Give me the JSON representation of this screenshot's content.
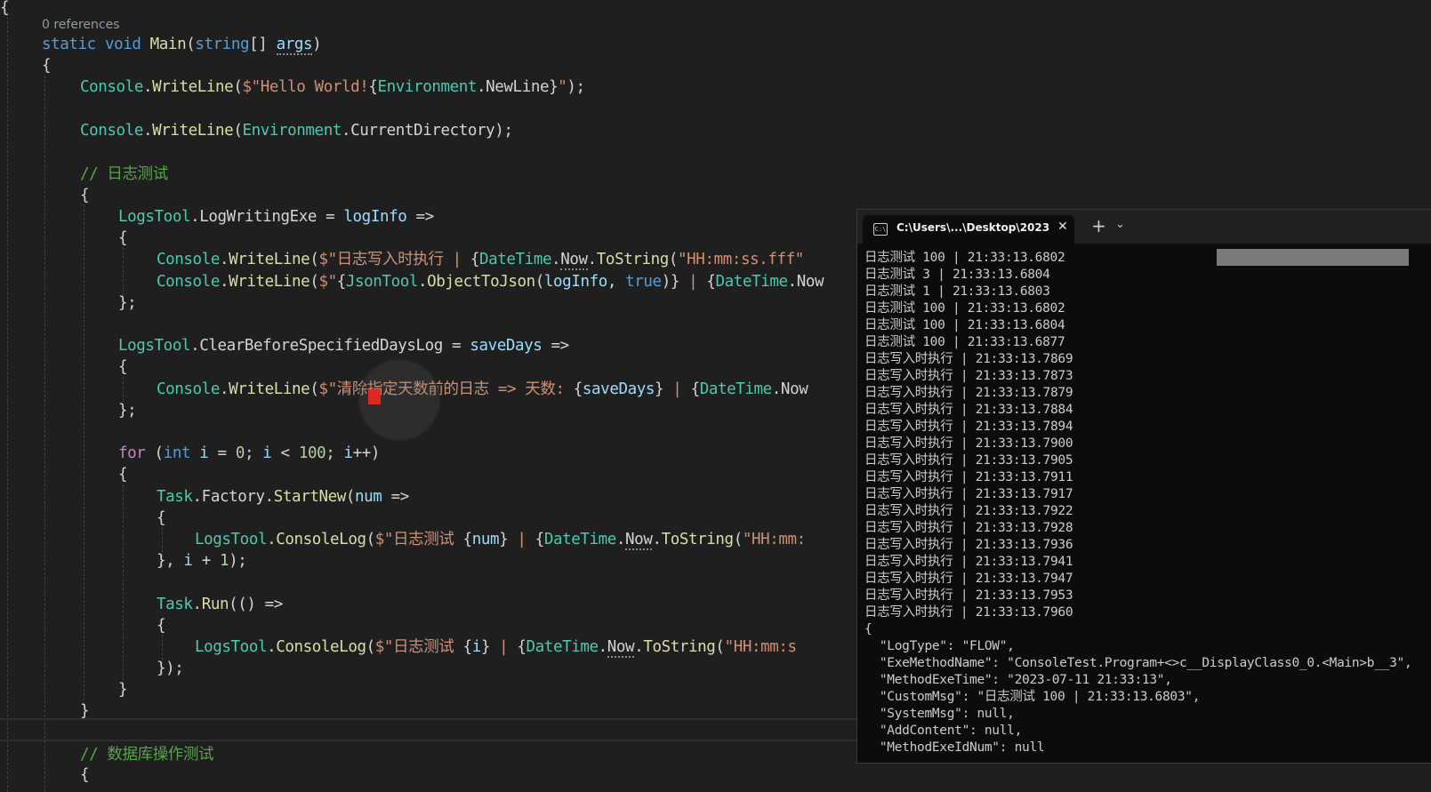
{
  "editor": {
    "references": "0 references",
    "lines": [
      {
        "spans": [
          {
            "c": "",
            "t": "{"
          }
        ]
      },
      {
        "spans": [
          {
            "c": "kw",
            "t": "static"
          },
          {
            "c": "",
            "t": " "
          },
          {
            "c": "kw",
            "t": "void"
          },
          {
            "c": "",
            "t": " "
          },
          {
            "c": "fn",
            "t": "Main"
          },
          {
            "c": "",
            "t": "("
          },
          {
            "c": "kw",
            "t": "string"
          },
          {
            "c": "",
            "t": "[] "
          },
          {
            "c": "var hint",
            "t": "args"
          },
          {
            "c": "",
            "t": ")"
          }
        ]
      },
      {
        "spans": [
          {
            "c": "",
            "t": "{"
          }
        ]
      },
      {
        "spans": [
          {
            "c": "ty",
            "t": "Console"
          },
          {
            "c": "",
            "t": "."
          },
          {
            "c": "fn",
            "t": "WriteLine"
          },
          {
            "c": "",
            "t": "("
          },
          {
            "c": "str",
            "t": "$\"Hello World!"
          },
          {
            "c": "",
            "t": "{"
          },
          {
            "c": "ty",
            "t": "Environment"
          },
          {
            "c": "",
            "t": ".NewLine}"
          },
          {
            "c": "str",
            "t": "\""
          },
          {
            "c": "",
            "t": ");"
          }
        ]
      },
      {
        "spans": [
          {
            "c": "ty",
            "t": "Console"
          },
          {
            "c": "",
            "t": "."
          },
          {
            "c": "fn",
            "t": "WriteLine"
          },
          {
            "c": "",
            "t": "("
          },
          {
            "c": "ty",
            "t": "Environment"
          },
          {
            "c": "",
            "t": ".CurrentDirectory);"
          }
        ]
      },
      {
        "spans": [
          {
            "c": "cm",
            "t": "// 日志测试"
          }
        ]
      },
      {
        "spans": [
          {
            "c": "",
            "t": "{"
          }
        ]
      },
      {
        "spans": [
          {
            "c": "ty",
            "t": "LogsTool"
          },
          {
            "c": "",
            "t": ".LogWritingExe = "
          },
          {
            "c": "var",
            "t": "logInfo"
          },
          {
            "c": "",
            "t": " =>"
          }
        ]
      },
      {
        "spans": [
          {
            "c": "",
            "t": "{"
          }
        ]
      },
      {
        "spans": [
          {
            "c": "ty",
            "t": "Console"
          },
          {
            "c": "",
            "t": "."
          },
          {
            "c": "fn",
            "t": "WriteLine"
          },
          {
            "c": "",
            "t": "("
          },
          {
            "c": "str",
            "t": "$\"日志写入时执行 | "
          },
          {
            "c": "",
            "t": "{"
          },
          {
            "c": "ty",
            "t": "DateTime"
          },
          {
            "c": "",
            "t": "."
          },
          {
            "c": "hint",
            "t": "Now"
          },
          {
            "c": "",
            "t": "."
          },
          {
            "c": "fn",
            "t": "ToString"
          },
          {
            "c": "",
            "t": "("
          },
          {
            "c": "str",
            "t": "\"HH:mm:ss.fff\""
          }
        ]
      },
      {
        "spans": [
          {
            "c": "ty",
            "t": "Console"
          },
          {
            "c": "",
            "t": "."
          },
          {
            "c": "fn",
            "t": "WriteLine"
          },
          {
            "c": "",
            "t": "("
          },
          {
            "c": "str",
            "t": "$\""
          },
          {
            "c": "",
            "t": "{"
          },
          {
            "c": "ty",
            "t": "JsonTool"
          },
          {
            "c": "",
            "t": "."
          },
          {
            "c": "fn",
            "t": "ObjectToJson"
          },
          {
            "c": "",
            "t": "("
          },
          {
            "c": "var",
            "t": "logInfo"
          },
          {
            "c": "",
            "t": ", "
          },
          {
            "c": "kw",
            "t": "true"
          },
          {
            "c": "",
            "t": ")}"
          },
          {
            "c": "str",
            "t": " | "
          },
          {
            "c": "",
            "t": "{"
          },
          {
            "c": "ty",
            "t": "DateTime"
          },
          {
            "c": "",
            "t": ".Now"
          }
        ]
      },
      {
        "spans": [
          {
            "c": "",
            "t": "};"
          }
        ]
      },
      {
        "spans": [
          {
            "c": "ty",
            "t": "LogsTool"
          },
          {
            "c": "",
            "t": ".ClearBeforeSpecifiedDaysLog = "
          },
          {
            "c": "var",
            "t": "saveDays"
          },
          {
            "c": "",
            "t": " =>"
          }
        ]
      },
      {
        "spans": [
          {
            "c": "",
            "t": "{"
          }
        ]
      },
      {
        "spans": [
          {
            "c": "ty",
            "t": "Console"
          },
          {
            "c": "",
            "t": "."
          },
          {
            "c": "fn",
            "t": "WriteLine"
          },
          {
            "c": "",
            "t": "("
          },
          {
            "c": "str",
            "t": "$\"清除指定天数前的日志 => 天数: "
          },
          {
            "c": "",
            "t": "{"
          },
          {
            "c": "var",
            "t": "saveDays"
          },
          {
            "c": "",
            "t": "}"
          },
          {
            "c": "str",
            "t": " | "
          },
          {
            "c": "",
            "t": "{"
          },
          {
            "c": "ty",
            "t": "DateTime"
          },
          {
            "c": "",
            "t": ".Now"
          }
        ]
      },
      {
        "spans": [
          {
            "c": "",
            "t": "};"
          }
        ]
      },
      {
        "spans": [
          {
            "c": "ctl",
            "t": "for"
          },
          {
            "c": "",
            "t": " ("
          },
          {
            "c": "kw",
            "t": "int"
          },
          {
            "c": "",
            "t": " "
          },
          {
            "c": "var",
            "t": "i"
          },
          {
            "c": "",
            "t": " = "
          },
          {
            "c": "num",
            "t": "0"
          },
          {
            "c": "",
            "t": "; "
          },
          {
            "c": "var",
            "t": "i"
          },
          {
            "c": "",
            "t": " < "
          },
          {
            "c": "num",
            "t": "100"
          },
          {
            "c": "",
            "t": "; "
          },
          {
            "c": "var",
            "t": "i"
          },
          {
            "c": "",
            "t": "++)"
          }
        ]
      },
      {
        "spans": [
          {
            "c": "",
            "t": "{"
          }
        ]
      },
      {
        "spans": [
          {
            "c": "ty",
            "t": "Task"
          },
          {
            "c": "",
            "t": ".Factory."
          },
          {
            "c": "fn",
            "t": "StartNew"
          },
          {
            "c": "",
            "t": "("
          },
          {
            "c": "var",
            "t": "num"
          },
          {
            "c": "",
            "t": " =>"
          }
        ]
      },
      {
        "spans": [
          {
            "c": "",
            "t": "{"
          }
        ]
      },
      {
        "spans": [
          {
            "c": "ty",
            "t": "LogsTool"
          },
          {
            "c": "",
            "t": "."
          },
          {
            "c": "fn",
            "t": "ConsoleLog"
          },
          {
            "c": "",
            "t": "("
          },
          {
            "c": "str",
            "t": "$\"日志测试 "
          },
          {
            "c": "",
            "t": "{"
          },
          {
            "c": "var",
            "t": "num"
          },
          {
            "c": "",
            "t": "}"
          },
          {
            "c": "str",
            "t": " | "
          },
          {
            "c": "",
            "t": "{"
          },
          {
            "c": "ty",
            "t": "DateTime"
          },
          {
            "c": "",
            "t": "."
          },
          {
            "c": "hint",
            "t": "Now"
          },
          {
            "c": "",
            "t": "."
          },
          {
            "c": "fn",
            "t": "ToString"
          },
          {
            "c": "",
            "t": "("
          },
          {
            "c": "str",
            "t": "\"HH:mm:"
          }
        ]
      },
      {
        "spans": [
          {
            "c": "",
            "t": "}, "
          },
          {
            "c": "var",
            "t": "i"
          },
          {
            "c": "",
            "t": " + "
          },
          {
            "c": "num",
            "t": "1"
          },
          {
            "c": "",
            "t": ");"
          }
        ]
      },
      {
        "spans": [
          {
            "c": "ty",
            "t": "Task"
          },
          {
            "c": "",
            "t": "."
          },
          {
            "c": "fn",
            "t": "Run"
          },
          {
            "c": "",
            "t": "(() =>"
          }
        ]
      },
      {
        "spans": [
          {
            "c": "",
            "t": "{"
          }
        ]
      },
      {
        "spans": [
          {
            "c": "ty",
            "t": "LogsTool"
          },
          {
            "c": "",
            "t": "."
          },
          {
            "c": "fn",
            "t": "ConsoleLog"
          },
          {
            "c": "",
            "t": "("
          },
          {
            "c": "str",
            "t": "$\"日志测试 "
          },
          {
            "c": "",
            "t": "{"
          },
          {
            "c": "var",
            "t": "i"
          },
          {
            "c": "",
            "t": "}"
          },
          {
            "c": "str",
            "t": " | "
          },
          {
            "c": "",
            "t": "{"
          },
          {
            "c": "ty",
            "t": "DateTime"
          },
          {
            "c": "",
            "t": "."
          },
          {
            "c": "hint",
            "t": "Now"
          },
          {
            "c": "",
            "t": "."
          },
          {
            "c": "fn",
            "t": "ToString"
          },
          {
            "c": "",
            "t": "("
          },
          {
            "c": "str",
            "t": "\"HH:mm:s"
          }
        ]
      },
      {
        "spans": [
          {
            "c": "",
            "t": "});"
          }
        ]
      },
      {
        "spans": [
          {
            "c": "",
            "t": "}"
          }
        ]
      },
      {
        "spans": [
          {
            "c": "",
            "t": "}"
          }
        ]
      },
      {
        "spans": [
          {
            "c": "cm",
            "t": "// 数据库操作测试"
          }
        ]
      },
      {
        "spans": [
          {
            "c": "",
            "t": "{"
          }
        ]
      }
    ]
  },
  "terminal": {
    "tab_title": "C:\\Users\\...\\Desktop\\2023",
    "close_glyph": "✕",
    "new_tab_glyph": "+",
    "dropdown_glyph": "⌄",
    "lines": [
      "日志测试 100 | 21:33:13.6802",
      "日志测试 3 | 21:33:13.6804",
      "日志测试 1 | 21:33:13.6803",
      "日志测试 100 | 21:33:13.6802",
      "日志测试 100 | 21:33:13.6804",
      "日志测试 100 | 21:33:13.6877",
      "日志写入时执行 | 21:33:13.7869",
      "日志写入时执行 | 21:33:13.7873",
      "日志写入时执行 | 21:33:13.7879",
      "日志写入时执行 | 21:33:13.7884",
      "日志写入时执行 | 21:33:13.7894",
      "日志写入时执行 | 21:33:13.7900",
      "日志写入时执行 | 21:33:13.7905",
      "日志写入时执行 | 21:33:13.7911",
      "日志写入时执行 | 21:33:13.7917",
      "日志写入时执行 | 21:33:13.7922",
      "日志写入时执行 | 21:33:13.7928",
      "日志写入时执行 | 21:33:13.7936",
      "日志写入时执行 | 21:33:13.7941",
      "日志写入时执行 | 21:33:13.7947",
      "日志写入时执行 | 21:33:13.7953",
      "日志写入时执行 | 21:33:13.7960",
      "{",
      "  \"LogType\": \"FLOW\",",
      "  \"ExeMethodName\": \"ConsoleTest.Program+<>c__DisplayClass0_0.<Main>b__3\",",
      "  \"MethodExeTime\": \"2023-07-11 21:33:13\",",
      "  \"CustomMsg\": \"日志测试 100 | 21:33:13.6803\",",
      "  \"SystemMsg\": null,",
      "  \"AddContent\": null,",
      "  \"MethodExeIdNum\": null"
    ]
  }
}
